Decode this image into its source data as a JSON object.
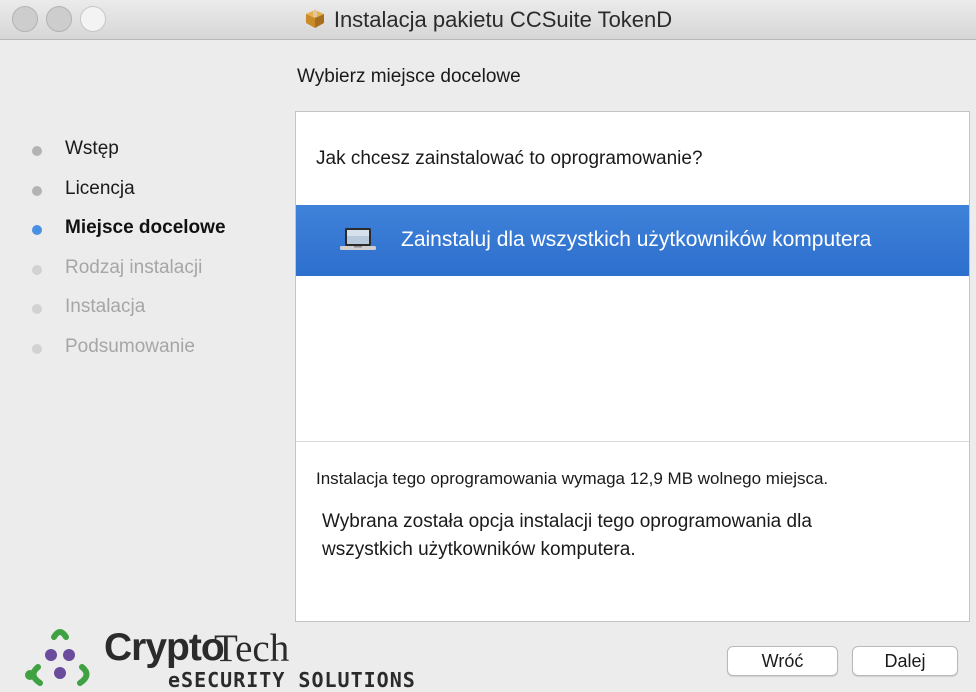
{
  "window": {
    "title": "Instalacja pakietu CCSuite TokenD",
    "title_icon": "package-icon"
  },
  "page_heading": "Wybierz miejsce docelowe",
  "steps": [
    {
      "label": "Wstęp",
      "state": "done"
    },
    {
      "label": "Licencja",
      "state": "done"
    },
    {
      "label": "Miejsce docelowe",
      "state": "active"
    },
    {
      "label": "Rodzaj instalacji",
      "state": "pending"
    },
    {
      "label": "Instalacja",
      "state": "pending"
    },
    {
      "label": "Podsumowanie",
      "state": "pending"
    }
  ],
  "panel": {
    "question": "Jak chcesz zainstalować to oprogramowanie?",
    "option": {
      "label": "Zainstaluj dla wszystkich użytkowników komputera",
      "icon": "laptop-icon",
      "selected": true
    },
    "space_required": "Instalacja tego oprogramowania wymaga 12,9 MB wolnego miejsca.",
    "description": "Wybrana została opcja instalacji tego oprogramowania dla wszystkich użytkowników komputera."
  },
  "logo": {
    "crypto": "Crypto",
    "tech": "Tech",
    "tagline": "eSECURITY SOLUTIONS"
  },
  "buttons": {
    "back": "Wróć",
    "next": "Dalej"
  },
  "colors": {
    "accent": "#2f72cf",
    "active_step_dot": "#4a90e2",
    "logo_green": "#3fa142",
    "logo_purple": "#6b4b9b"
  }
}
